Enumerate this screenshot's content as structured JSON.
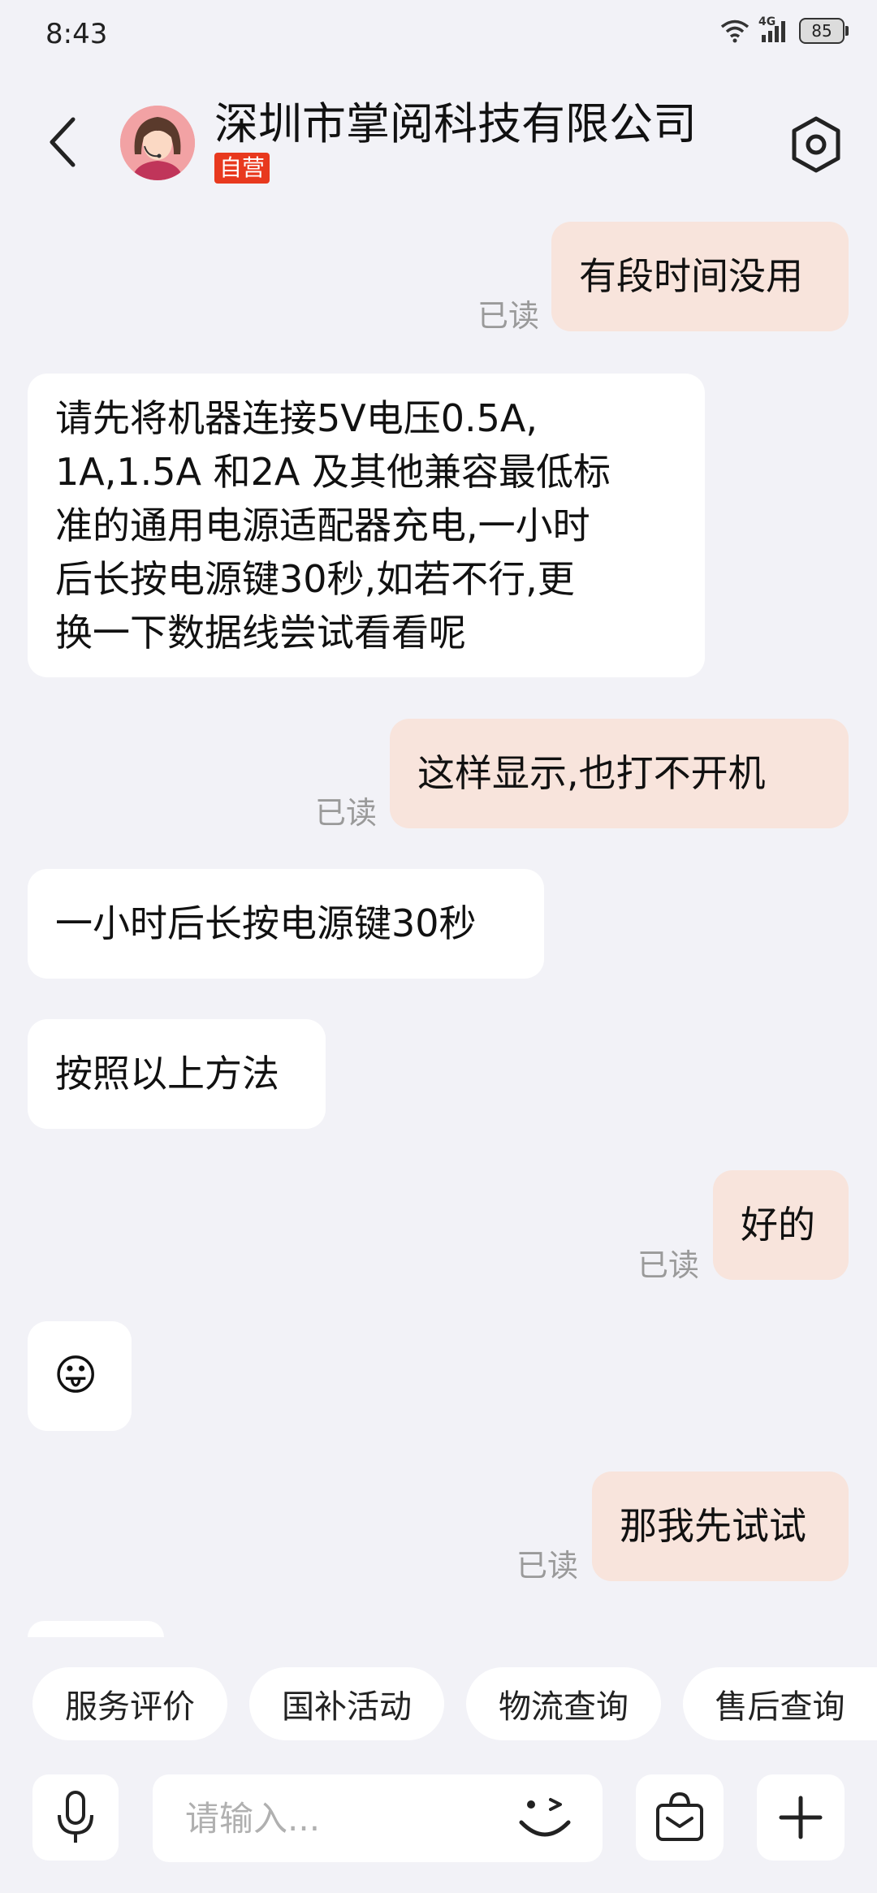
{
  "status": {
    "time": "8:43",
    "network": "4G",
    "battery": "85"
  },
  "header": {
    "title": "深圳市掌阅科技有限公司",
    "badge": "自营"
  },
  "messages": [
    {
      "side": "me",
      "text": "有段时间没用",
      "read": "已读"
    },
    {
      "side": "them",
      "lines": [
        "请先将机器连接5V电压0.5A,",
        "1A,1.5A 和2A 及其他兼容最低标",
        "准的通用电源适配器充电,一小时",
        "后长按电源键30秒,如若不行,更",
        "换一下数据线尝试看看呢"
      ]
    },
    {
      "side": "me",
      "text": "这样显示,也打不开机",
      "read": "已读"
    },
    {
      "side": "them",
      "text": "一小时后长按电源键30秒"
    },
    {
      "side": "them",
      "text": "按照以上方法"
    },
    {
      "side": "me",
      "text": "好的",
      "read": "已读"
    },
    {
      "side": "them",
      "emoji": "😛"
    },
    {
      "side": "me",
      "text": "那我先试试",
      "read": "已读"
    }
  ],
  "quick_actions": [
    "服务评价",
    "国补活动",
    "物流查询",
    "售后查询"
  ],
  "input": {
    "placeholder": "请输入..."
  },
  "colors": {
    "my_bubble": "#f8e4dc",
    "their_bubble": "#ffffff",
    "badge": "#e8391e",
    "background": "#f2f2f7"
  }
}
